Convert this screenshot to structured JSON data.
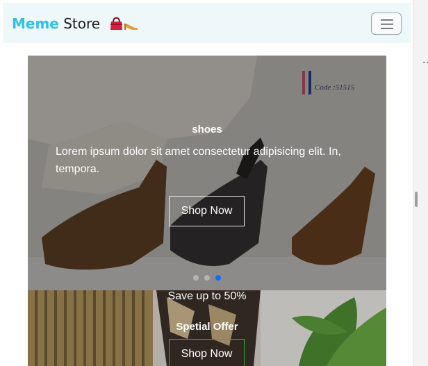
{
  "navbar": {
    "brand_accent": "Meme",
    "brand_main": " Store",
    "brand_icons": [
      "handbag-icon",
      "high-heel-icon"
    ],
    "toggler_icon": "hamburger-icon"
  },
  "carousel": {
    "active_index": 2,
    "slide_count": 3,
    "code_label": "Code :51515",
    "caption_title": "shoes",
    "caption_text": "Lorem ipsum dolor sit amet consectetur adipisicing elit. In, tempora.",
    "button_label": "Shop Now"
  },
  "offer": {
    "subtitle": "Save up to 50%",
    "title": "Spetial Offer",
    "button_label": "Shop Now"
  },
  "colors": {
    "brand_accent": "#2fc0ea",
    "active_indicator": "#0d6efd",
    "offer_button_border": "#35b04a"
  }
}
